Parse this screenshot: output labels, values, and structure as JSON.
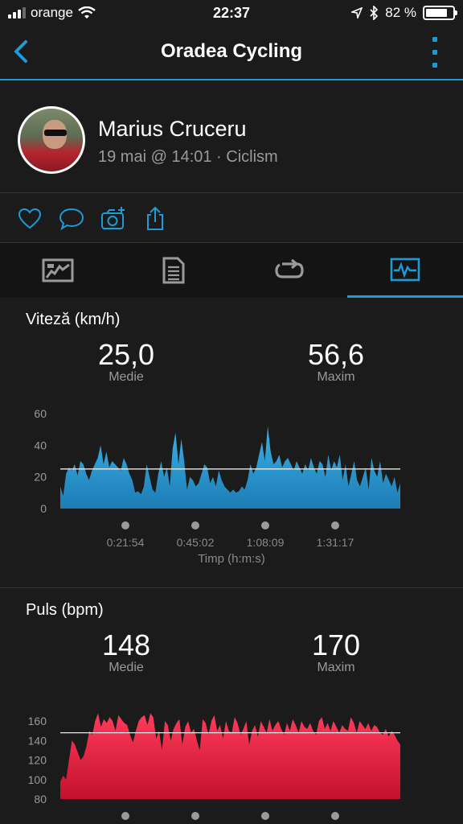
{
  "status_bar": {
    "carrier": "orange",
    "time": "22:37",
    "battery": "82 %",
    "battery_level": 0.82
  },
  "nav": {
    "title": "Oradea Cycling"
  },
  "profile": {
    "name": "Marius Cruceru",
    "meta": "19 mai @ 14:01 · Ciclism"
  },
  "actions": [
    "heart-icon",
    "comment-icon",
    "camera-add-icon",
    "share-icon"
  ],
  "tabs": [
    "map-summary-icon",
    "details-icon",
    "laps-icon",
    "charts-icon"
  ],
  "speed": {
    "title": "Viteză (km/h)",
    "avg_value": "25,0",
    "avg_label": "Medie",
    "max_value": "56,6",
    "max_label": "Maxim",
    "x_axis_label": "Timp (h:m:s)"
  },
  "heart_rate": {
    "title": "Puls (bpm)",
    "avg_value": "148",
    "avg_label": "Medie",
    "max_value": "170",
    "max_label": "Maxim"
  },
  "chart_data": [
    {
      "type": "area",
      "title": "Viteză (km/h)",
      "xlabel": "Timp (h:m:s)",
      "ylim": [
        0,
        60
      ],
      "yticks": [
        "0",
        "20",
        "40",
        "60"
      ],
      "xticks": [
        "0:21:54",
        "0:45:02",
        "1:08:09",
        "1:31:17"
      ],
      "average_line": 25.0,
      "color": "#2ba8de",
      "values": [
        14,
        8,
        22,
        26,
        24,
        28,
        21,
        30,
        28,
        22,
        18,
        24,
        28,
        32,
        40,
        28,
        36,
        26,
        30,
        28,
        26,
        24,
        32,
        28,
        22,
        18,
        10,
        11,
        9,
        14,
        28,
        20,
        12,
        10,
        22,
        30,
        20,
        26,
        14,
        38,
        48,
        28,
        44,
        30,
        12,
        20,
        18,
        14,
        16,
        22,
        28,
        26,
        16,
        20,
        14,
        24,
        18,
        14,
        12,
        10,
        12,
        10,
        11,
        14,
        12,
        18,
        28,
        22,
        26,
        34,
        42,
        30,
        52,
        36,
        28,
        30,
        34,
        26,
        30,
        32,
        28,
        24,
        30,
        26,
        22,
        28,
        24,
        32,
        26,
        22,
        30,
        28,
        20,
        34,
        24,
        30,
        26,
        34,
        18,
        28,
        14,
        22,
        30,
        18,
        14,
        20,
        26,
        12,
        32,
        24,
        20,
        30,
        16,
        22,
        18,
        14,
        20,
        10,
        16
      ]
    },
    {
      "type": "area",
      "title": "Puls (bpm)",
      "ylim": [
        80,
        170
      ],
      "yticks": [
        "80",
        "100",
        "120",
        "140",
        "160"
      ],
      "average_line": 148,
      "color": "#e21b3a",
      "values": [
        98,
        104,
        100,
        120,
        140,
        136,
        128,
        120,
        124,
        134,
        150,
        146,
        160,
        168,
        154,
        162,
        158,
        164,
        160,
        150,
        166,
        162,
        158,
        156,
        146,
        138,
        150,
        160,
        164,
        166,
        156,
        168,
        164,
        142,
        150,
        130,
        160,
        156,
        140,
        152,
        158,
        162,
        136,
        154,
        160,
        148,
        152,
        140,
        130,
        162,
        158,
        146,
        160,
        166,
        150,
        156,
        142,
        160,
        150,
        148,
        164,
        158,
        146,
        152,
        160,
        136,
        150,
        156,
        144,
        160,
        154,
        148,
        162,
        150,
        156,
        160,
        152,
        146,
        158,
        150,
        162,
        156,
        148,
        160,
        154,
        152,
        158,
        150,
        146,
        160,
        164,
        152,
        158,
        150,
        160,
        154,
        148,
        156,
        152,
        150,
        164,
        158,
        148,
        160,
        156,
        152,
        158,
        150,
        156,
        154,
        148,
        146,
        152,
        144,
        150,
        146,
        140,
        136
      ]
    }
  ]
}
